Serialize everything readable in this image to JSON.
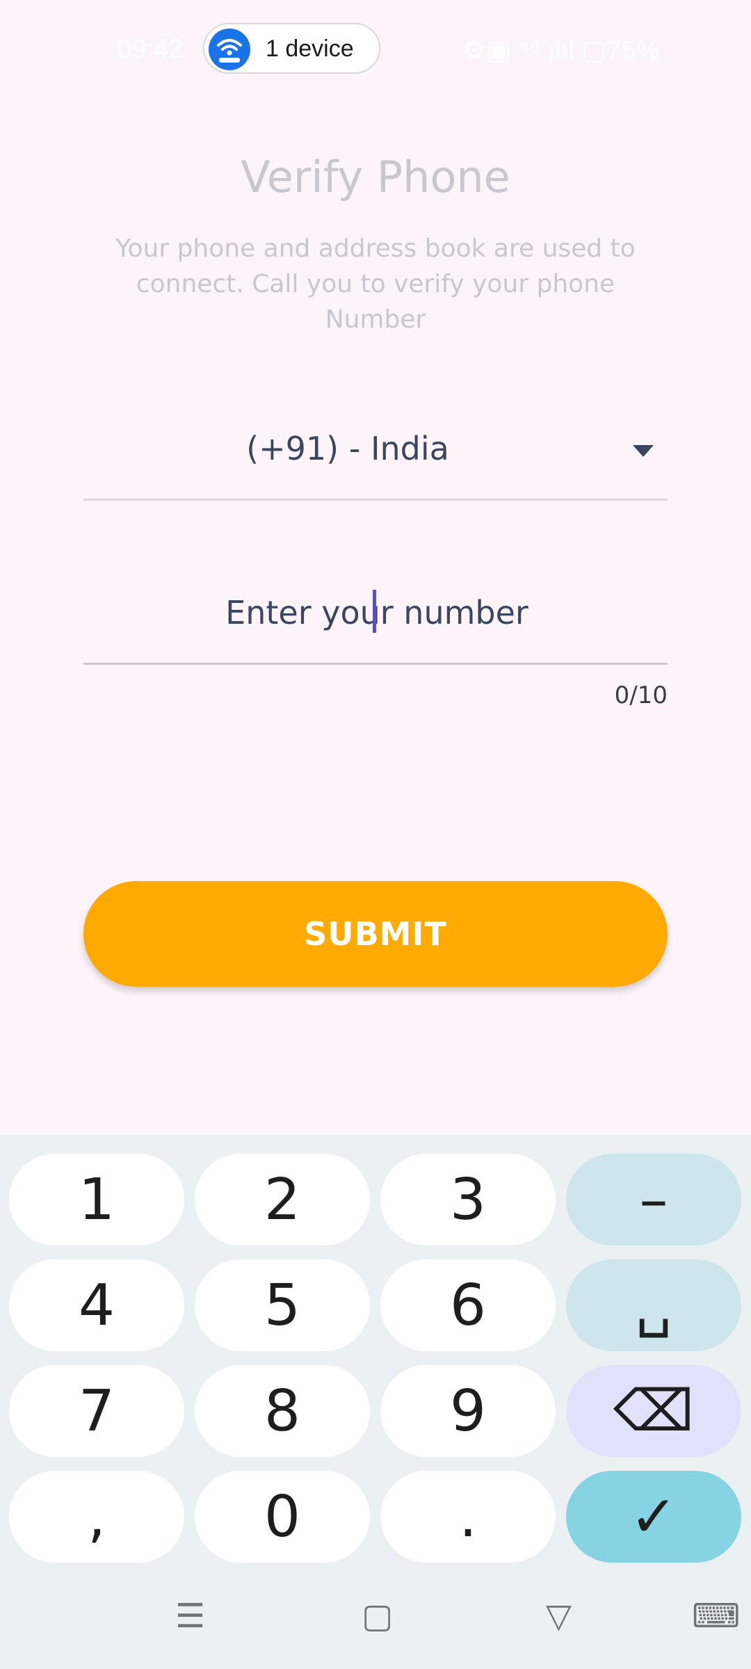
{
  "status_bar": {
    "time": "09:42",
    "icons_text": "⚙▣ ⁴⁶ ılıl ▢75%",
    "device_pill_label": "1 device"
  },
  "screen": {
    "title": "Verify Phone",
    "subtitle": "Your phone and address book are used to connect. Call you to verify your phone Number",
    "country_select_value": "(+91) - India",
    "phone_input": {
      "value": "",
      "placeholder": "Enter your number"
    },
    "char_counter": "0/10",
    "submit_label": "SUBMIT"
  },
  "keyboard": {
    "keys": [
      "1",
      "2",
      "3",
      "–",
      "4",
      "5",
      "6",
      "␣",
      "7",
      "8",
      "9",
      "⌫",
      ",",
      "0",
      ".",
      "✓"
    ]
  },
  "nav_bar": {
    "items": [
      "☰",
      "▢",
      "▽",
      "⌨"
    ]
  },
  "colors": {
    "accent": "#ffaa00",
    "background": "#fdf4fa",
    "text": "#3a4660",
    "muted": "#c9c6cf"
  }
}
